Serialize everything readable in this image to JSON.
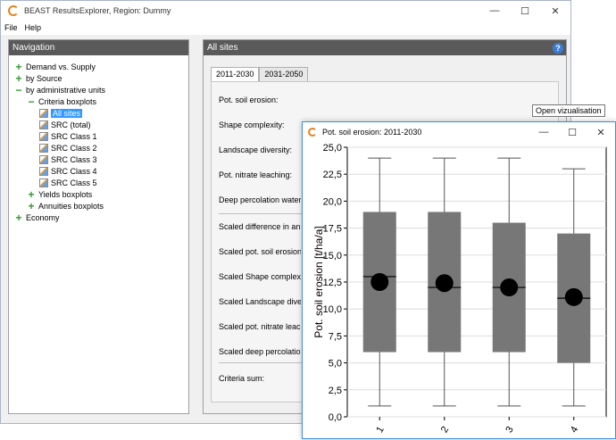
{
  "app": {
    "title": "BEAST ResultsExplorer, Region: Dummy",
    "controls": {
      "minimize": "—",
      "maximize": "☐",
      "close": "✕"
    }
  },
  "menu": {
    "items": [
      "File",
      "Help"
    ]
  },
  "navigation": {
    "header": "Navigation",
    "tree": [
      {
        "label": "Demand vs. Supply",
        "toggle": "+",
        "level": 0
      },
      {
        "label": "by Source",
        "toggle": "+",
        "level": 0
      },
      {
        "label": "by administrative units",
        "toggle": "−",
        "level": 0
      },
      {
        "label": "Criteria boxplots",
        "toggle": "−",
        "level": 1
      },
      {
        "label": "All sites",
        "icon": "chart-leaf-icon",
        "level": 2,
        "selected": true
      },
      {
        "label": "SRC (total)",
        "icon": "chart-leaf-icon",
        "level": 2
      },
      {
        "label": "SRC Class 1",
        "icon": "chart-leaf-icon",
        "level": 2
      },
      {
        "label": "SRC Class 2",
        "icon": "chart-leaf-icon",
        "level": 2
      },
      {
        "label": "SRC Class 3",
        "icon": "chart-leaf-icon",
        "level": 2
      },
      {
        "label": "SRC Class 4",
        "icon": "chart-leaf-icon",
        "level": 2
      },
      {
        "label": "SRC Class 5",
        "icon": "chart-leaf-icon",
        "level": 2
      },
      {
        "label": "Yields boxplots",
        "toggle": "+",
        "level": 1
      },
      {
        "label": "Annuities boxplots",
        "toggle": "+",
        "level": 1
      },
      {
        "label": "Economy",
        "toggle": "+",
        "level": 0
      }
    ]
  },
  "content": {
    "header": "All sites",
    "help_icon": "?",
    "tabs": [
      {
        "label": "2011-2030",
        "active": true
      },
      {
        "label": "2031-2050",
        "active": false
      }
    ],
    "criteria": [
      "Pot. soil erosion:",
      "Shape complexity:",
      "Landscape diversity:",
      "Pot. nitrate leaching:",
      "Deep percolation water:",
      "Scaled difference in anuities:",
      "Scaled pot. soil erosion:",
      "Scaled Shape complexity:",
      "Scaled Landscape diversity:",
      "Scaled pot. nitrate leaching:",
      "Scaled deep percolation water:",
      "Criteria sum:"
    ]
  },
  "tooltip": "Open vizualisation",
  "popup": {
    "title": "Pot. soil erosion: 2011-2030",
    "controls": {
      "minimize": "—",
      "maximize": "☐",
      "close": "✕"
    }
  },
  "colors": {
    "box_fill": "#777777",
    "mean_marker": "#000000",
    "selection": "#3399ff",
    "header_bg": "#5a5a5a"
  },
  "chart_data": {
    "type": "boxplot",
    "ylabel": "Pot. soil erosion [t/ha/a]",
    "ylim": [
      0,
      25
    ],
    "yticks": [
      "0,0",
      "2,5",
      "5,0",
      "7,5",
      "10,0",
      "12,5",
      "15,0",
      "17,5",
      "20,0",
      "22,5",
      "25,0"
    ],
    "categories": [
      "1",
      "2",
      "3",
      "4"
    ],
    "boxes": [
      {
        "min": 1.0,
        "q1": 6.0,
        "median": 13.0,
        "q3": 19.0,
        "max": 24.0,
        "mean": 12.5
      },
      {
        "min": 1.0,
        "q1": 6.0,
        "median": 12.0,
        "q3": 19.0,
        "max": 24.0,
        "mean": 12.4
      },
      {
        "min": 1.0,
        "q1": 6.0,
        "median": 12.0,
        "q3": 18.0,
        "max": 24.0,
        "mean": 12.0
      },
      {
        "min": 1.0,
        "q1": 5.0,
        "median": 11.0,
        "q3": 17.0,
        "max": 23.0,
        "mean": 11.1
      }
    ]
  }
}
